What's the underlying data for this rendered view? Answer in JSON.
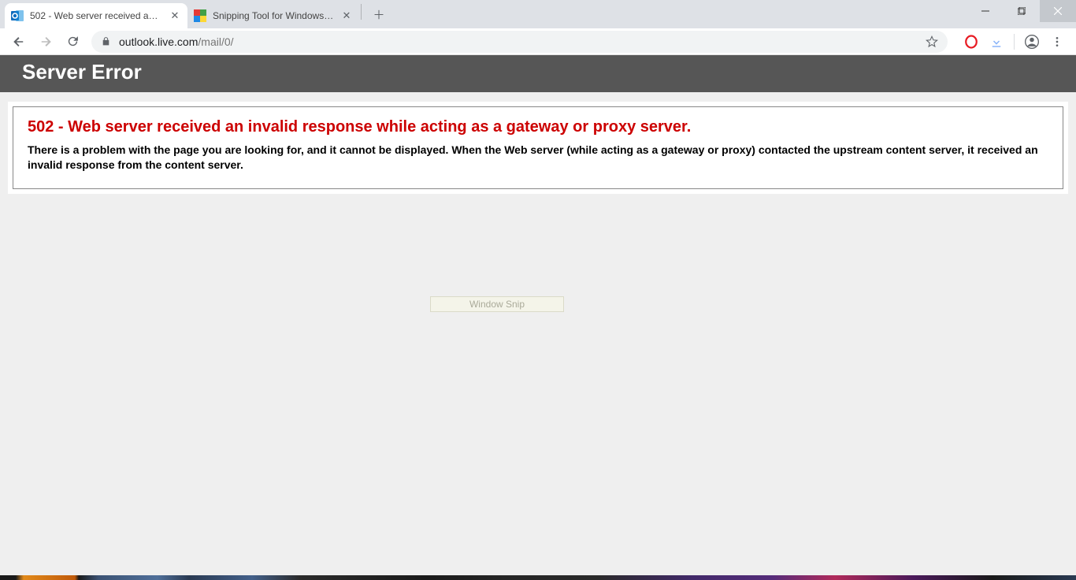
{
  "tabs": [
    {
      "title": "502 - Web server received an inv",
      "active": true
    },
    {
      "title": "Snipping Tool for Windows 10/8",
      "active": false
    }
  ],
  "window_controls": {
    "minimize": "−",
    "maximize": "❐",
    "close": "✕"
  },
  "toolbar": {
    "url_host": "outlook.live.com",
    "url_path": "/mail/0/"
  },
  "page": {
    "header": "Server Error",
    "error_heading": "502 - Web server received an invalid response while acting as a gateway or proxy server.",
    "error_body": "There is a problem with the page you are looking for, and it cannot be displayed. When the Web server (while acting as a gateway or proxy) contacted the upstream content server, it received an invalid response from the content server."
  },
  "ghost_tooltip": "Window Snip"
}
